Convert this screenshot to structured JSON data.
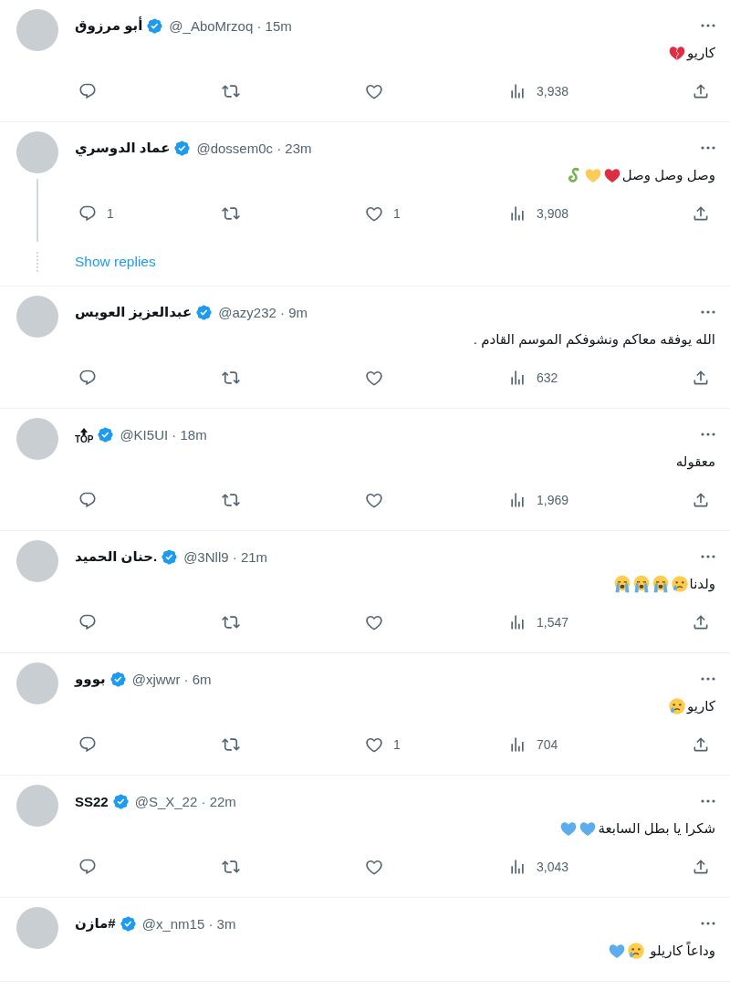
{
  "tweets": [
    {
      "name": "أبو مرزوق",
      "verified": true,
      "handle_line": "@_AboMrzoq · 15m",
      "text": "كاريو",
      "emojis": [
        {
          "kind": "broken_heart"
        }
      ],
      "actions": {
        "views": "3,938"
      }
    },
    {
      "name": "عماد الدوسري",
      "verified": true,
      "handle_line": "@dossem0c · 23m",
      "text": "وصل وصل وصل",
      "emojis": [
        {
          "kind": "red_heart"
        },
        {
          "kind": "yellow_heart"
        },
        {
          "kind": "snake"
        }
      ],
      "thread": true,
      "actions": {
        "replies": "1",
        "likes": "1",
        "views": "3,908"
      },
      "show_replies": "Show replies"
    },
    {
      "name": "عبدالعزيز العويس",
      "verified": true,
      "handle_line": "@azy232 · 9m",
      "text": "الله يوفقه معاكم ونشوفكم الموسم القادم .",
      "actions": {
        "views": "632"
      }
    },
    {
      "name": "TOP",
      "name_icon": {
        "kind": "up_arrow"
      },
      "verified": true,
      "handle_line": "@KI5UI · 18m",
      "text": "معقوله",
      "actions": {
        "views": "1,969"
      }
    },
    {
      "name": "حنان الحميد.",
      "verified": true,
      "handle_line": "@3Nll9 · 21m",
      "text": "ولدنا",
      "emojis": [
        {
          "kind": "crying"
        },
        {
          "kind": "sobbing"
        },
        {
          "kind": "sobbing"
        },
        {
          "kind": "sobbing"
        }
      ],
      "actions": {
        "views": "1,547"
      }
    },
    {
      "name": "بووو",
      "verified": true,
      "handle_line": "@xjwwr · 6m",
      "text": "كاريو",
      "emojis": [
        {
          "kind": "crying"
        }
      ],
      "actions": {
        "likes": "1",
        "views": "704"
      }
    },
    {
      "name": "SS22",
      "verified": true,
      "handle_line": "@S_X_22 · 22m",
      "text": "شكرا يا بطل السابعة",
      "emojis": [
        {
          "kind": "blue_heart"
        },
        {
          "kind": "blue_heart"
        }
      ],
      "actions": {
        "views": "3,043"
      }
    },
    {
      "name": "مازن#",
      "verified": true,
      "handle_line": "@x_nm15 · 3m",
      "text": "وداعاً كاريلو ",
      "emojis": [
        {
          "kind": "crying"
        },
        {
          "kind": "blue_heart"
        }
      ]
    }
  ]
}
